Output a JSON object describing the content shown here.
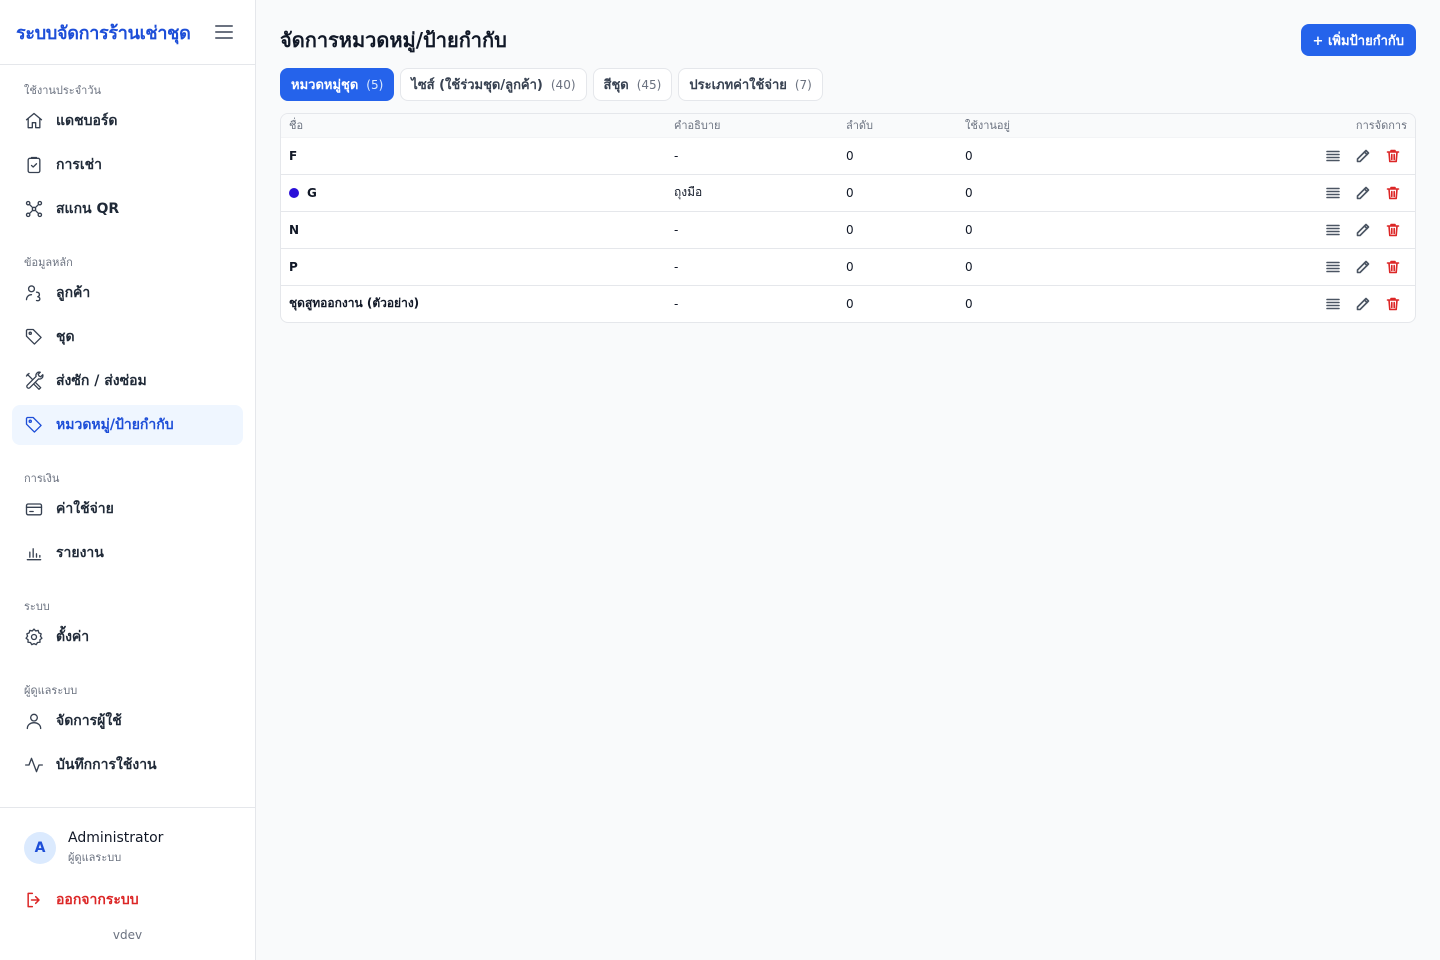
{
  "app": {
    "title": "ระบบจัดการร้านเช่าชุด"
  },
  "sidebar": {
    "sections": [
      {
        "label": "ใช้งานประจำวัน"
      },
      {
        "label": "ข้อมูลหลัก"
      },
      {
        "label": "การเงิน"
      },
      {
        "label": "ระบบ"
      },
      {
        "label": "ผู้ดูแลระบบ"
      }
    ],
    "items": [
      {
        "label": "แดชบอร์ด",
        "icon": "home-icon"
      },
      {
        "label": "การเช่า",
        "icon": "clipboard-check-icon"
      },
      {
        "label": "สแกน QR",
        "icon": "qr-scan-icon"
      },
      {
        "label": "ลูกค้า",
        "icon": "users-icon"
      },
      {
        "label": "ชุด",
        "icon": "tag-icon"
      },
      {
        "label": "ส่งซัก / ส่งซ่อม",
        "icon": "tools-icon"
      },
      {
        "label": "หมวดหมู่/ป้ายกำกับ",
        "icon": "tag-icon",
        "active": true
      },
      {
        "label": "ค่าใช้จ่าย",
        "icon": "credit-card-icon"
      },
      {
        "label": "รายงาน",
        "icon": "bar-chart-icon"
      },
      {
        "label": "ตั้งค่า",
        "icon": "gear-icon"
      },
      {
        "label": "จัดการผู้ใช้",
        "icon": "user-icon"
      },
      {
        "label": "บันทึกการใช้งาน",
        "icon": "activity-icon"
      }
    ]
  },
  "user": {
    "initial": "A",
    "name": "Administrator",
    "role": "ผู้ดูแลระบบ"
  },
  "logout": {
    "label": "ออกจากระบบ"
  },
  "version": "vdev",
  "page": {
    "title": "จัดการหมวดหมู่/ป้ายกำกับ",
    "add_button": "+ เพิ่มป้ายกำกับ"
  },
  "tabs": [
    {
      "label": "หมวดหมู่ชุด",
      "count": "(5)",
      "active": true
    },
    {
      "label": "ไซส์ (ใช้ร่วมชุด/ลูกค้า)",
      "count": "(40)"
    },
    {
      "label": "สีชุด",
      "count": "(45)"
    },
    {
      "label": "ประเภทค่าใช้จ่าย",
      "count": "(7)"
    }
  ],
  "table": {
    "headers": {
      "name": "ชื่อ",
      "description": "คำอธิบาย",
      "order": "ลำดับ",
      "in_use": "ใช้งานอยู่",
      "actions": "การจัดการ"
    },
    "rows": [
      {
        "name": "F",
        "description": "-",
        "order": "0",
        "in_use": "0"
      },
      {
        "name": "G",
        "description": "ถุงมือ",
        "order": "0",
        "in_use": "0",
        "color": "#2a0fd8"
      },
      {
        "name": "N",
        "description": "-",
        "order": "0",
        "in_use": "0"
      },
      {
        "name": "P",
        "description": "-",
        "order": "0",
        "in_use": "0"
      },
      {
        "name": "ชุดสูทออกงาน (ตัวอย่าง)",
        "description": "-",
        "order": "0",
        "in_use": "0"
      }
    ]
  },
  "colors": {
    "accent": "#2563eb",
    "danger": "#dc2626",
    "active_bg": "#eff6ff"
  }
}
